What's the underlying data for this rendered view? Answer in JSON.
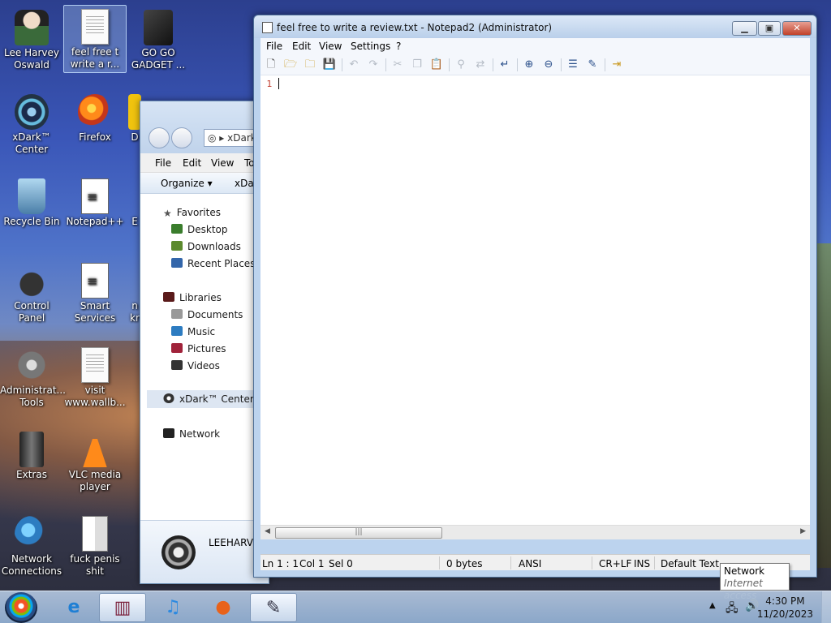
{
  "desktop": {
    "icons": [
      {
        "label": "Lee Harvey Oswald",
        "icon": "user-folder-icon"
      },
      {
        "label": "feel free t write a r...",
        "icon": "text-document-icon",
        "selected": true
      },
      {
        "label": "GO GO GADGET ...",
        "icon": "dark-folder-icon"
      },
      {
        "label": "xDark™ Center",
        "icon": "xdark-center-icon"
      },
      {
        "label": "Firefox",
        "icon": "firefox-icon"
      },
      {
        "label": "D",
        "icon": "folder-icon"
      },
      {
        "label": "Recycle Bin",
        "icon": "recycle-bin-icon"
      },
      {
        "label": "Notepad++",
        "icon": "notepad-plus-plus-icon"
      },
      {
        "label": "E",
        "icon": "app-icon"
      },
      {
        "label": "Control Panel",
        "icon": "control-panel-icon"
      },
      {
        "label": "Smart Services",
        "icon": "smart-services-icon"
      },
      {
        "label": "n kr",
        "icon": "app-icon"
      },
      {
        "label": "Administrat... Tools",
        "icon": "admin-tools-icon"
      },
      {
        "label": "visit www.wallb...",
        "icon": "text-document-icon"
      },
      {
        "label": "Extras",
        "icon": "extras-icon"
      },
      {
        "label": "VLC media player",
        "icon": "vlc-icon"
      },
      {
        "label": "Network Connections",
        "icon": "network-connections-icon"
      },
      {
        "label": "fuck penis shit",
        "icon": "document-icon"
      }
    ]
  },
  "explorer": {
    "address": "xDark",
    "menu": [
      "File",
      "Edit",
      "View",
      "To"
    ],
    "command_bar": {
      "organize": "Organize ▾",
      "path_item": "xDar"
    },
    "nav": {
      "favorites": "Favorites",
      "desktop": "Desktop",
      "downloads": "Downloads",
      "recent": "Recent Places",
      "libraries": "Libraries",
      "documents": "Documents",
      "music": "Music",
      "pictures": "Pictures",
      "videos": "Videos",
      "xdark": "xDark™ Center",
      "network": "Network"
    },
    "status_name": "LEEHARVE"
  },
  "notepad": {
    "title": "feel free to write a review.txt - Notepad2 (Administrator)",
    "menu": [
      "File",
      "Edit",
      "View",
      "Settings",
      "?"
    ],
    "line_number": "1",
    "scroll_thumb": "|||",
    "status": {
      "position": "Ln 1 : 1",
      "col": "Col 1",
      "sel": "Sel 0",
      "size": "0 bytes",
      "encoding": "ANSI",
      "eol": "CR+LF",
      "mode": "INS",
      "scheme": "Default Text"
    }
  },
  "tooltip": {
    "title": "Network",
    "subtitle": "Internet access"
  },
  "taskbar": {
    "time": "4:30 PM",
    "date": "11/20/2023",
    "pinned": [
      "internet-explorer-icon",
      "winrar-icon",
      "music-icon",
      "firefox-icon",
      "notepad2-icon"
    ]
  },
  "colors": {
    "line_number": "#c0392b",
    "title_bar": "#dce8f7",
    "taskbar": "#a9c2e0"
  }
}
